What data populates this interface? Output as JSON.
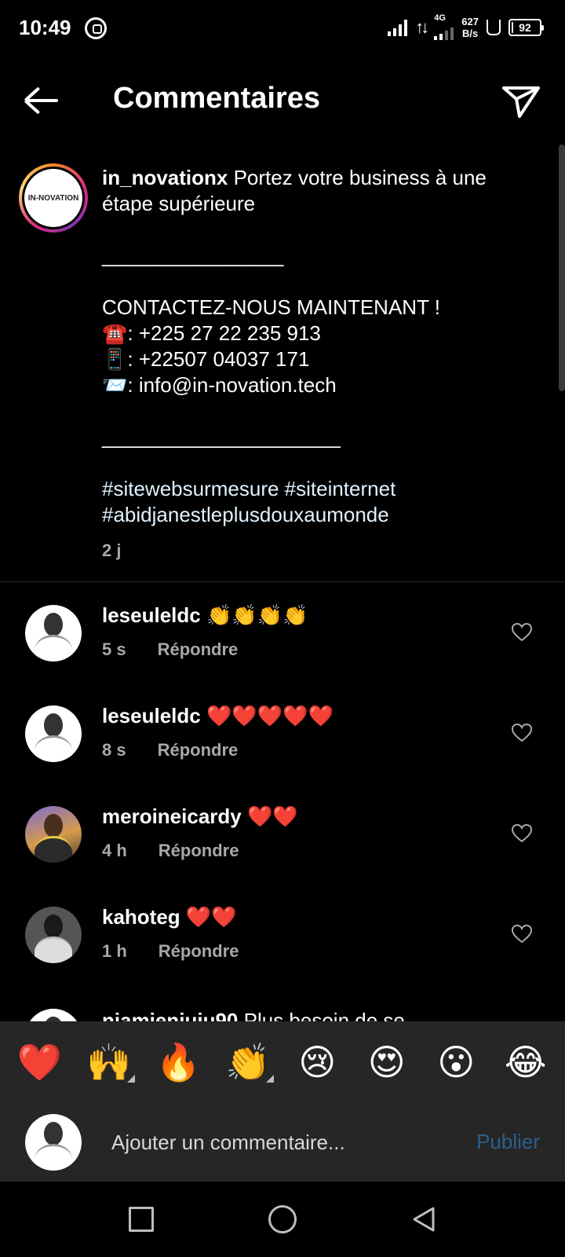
{
  "status_bar": {
    "time": "10:49",
    "network_type": "4G",
    "speed_value": "627",
    "speed_unit": "B/s",
    "battery": "92"
  },
  "header": {
    "title": "Commentaires",
    "back_icon": "arrow-left-icon",
    "send_icon": "paper-plane-icon"
  },
  "caption": {
    "avatar_logo": "IN-NOVATION",
    "username": "in_novationx",
    "text_first": "Portez votre business à une étape supérieure",
    "separator1": "________________",
    "contact_heading": "CONTACTEZ-NOUS MAINTENANT !",
    "phone1": "☎️: +225 27 22 235 913",
    "phone2": "📱: +22507 04037 171",
    "email": "📨: info@in-novation.tech",
    "separator2": "_____________________",
    "hashtags1": "#sitewebsurmesure #siteinternet",
    "hashtags2": "#abidjanestleplusdouxaumonde",
    "time": "2 j"
  },
  "comments": [
    {
      "username": "leseuleldc",
      "text": "👏👏👏👏",
      "time": "5 s",
      "reply_label": "Répondre"
    },
    {
      "username": "leseuleldc",
      "text": "❤️❤️❤️❤️❤️",
      "time": "8 s",
      "reply_label": "Répondre"
    },
    {
      "username": "meroineicardy",
      "text": "❤️❤️",
      "time": "4 h",
      "reply_label": "Répondre"
    },
    {
      "username": "kahoteg",
      "text": "❤️❤️",
      "time": "1 h",
      "reply_label": "Répondre"
    },
    {
      "username": "niamienjuju90",
      "text": "Plus besoin de se",
      "time": "",
      "reply_label": ""
    }
  ],
  "reactions": [
    "❤️",
    "🙌",
    "🔥",
    "👏",
    "😢",
    "😍",
    "😮",
    "😂"
  ],
  "composer": {
    "placeholder": "Ajouter un commentaire...",
    "publish_label": "Publier",
    "publish_color": "#2b5f8f"
  }
}
